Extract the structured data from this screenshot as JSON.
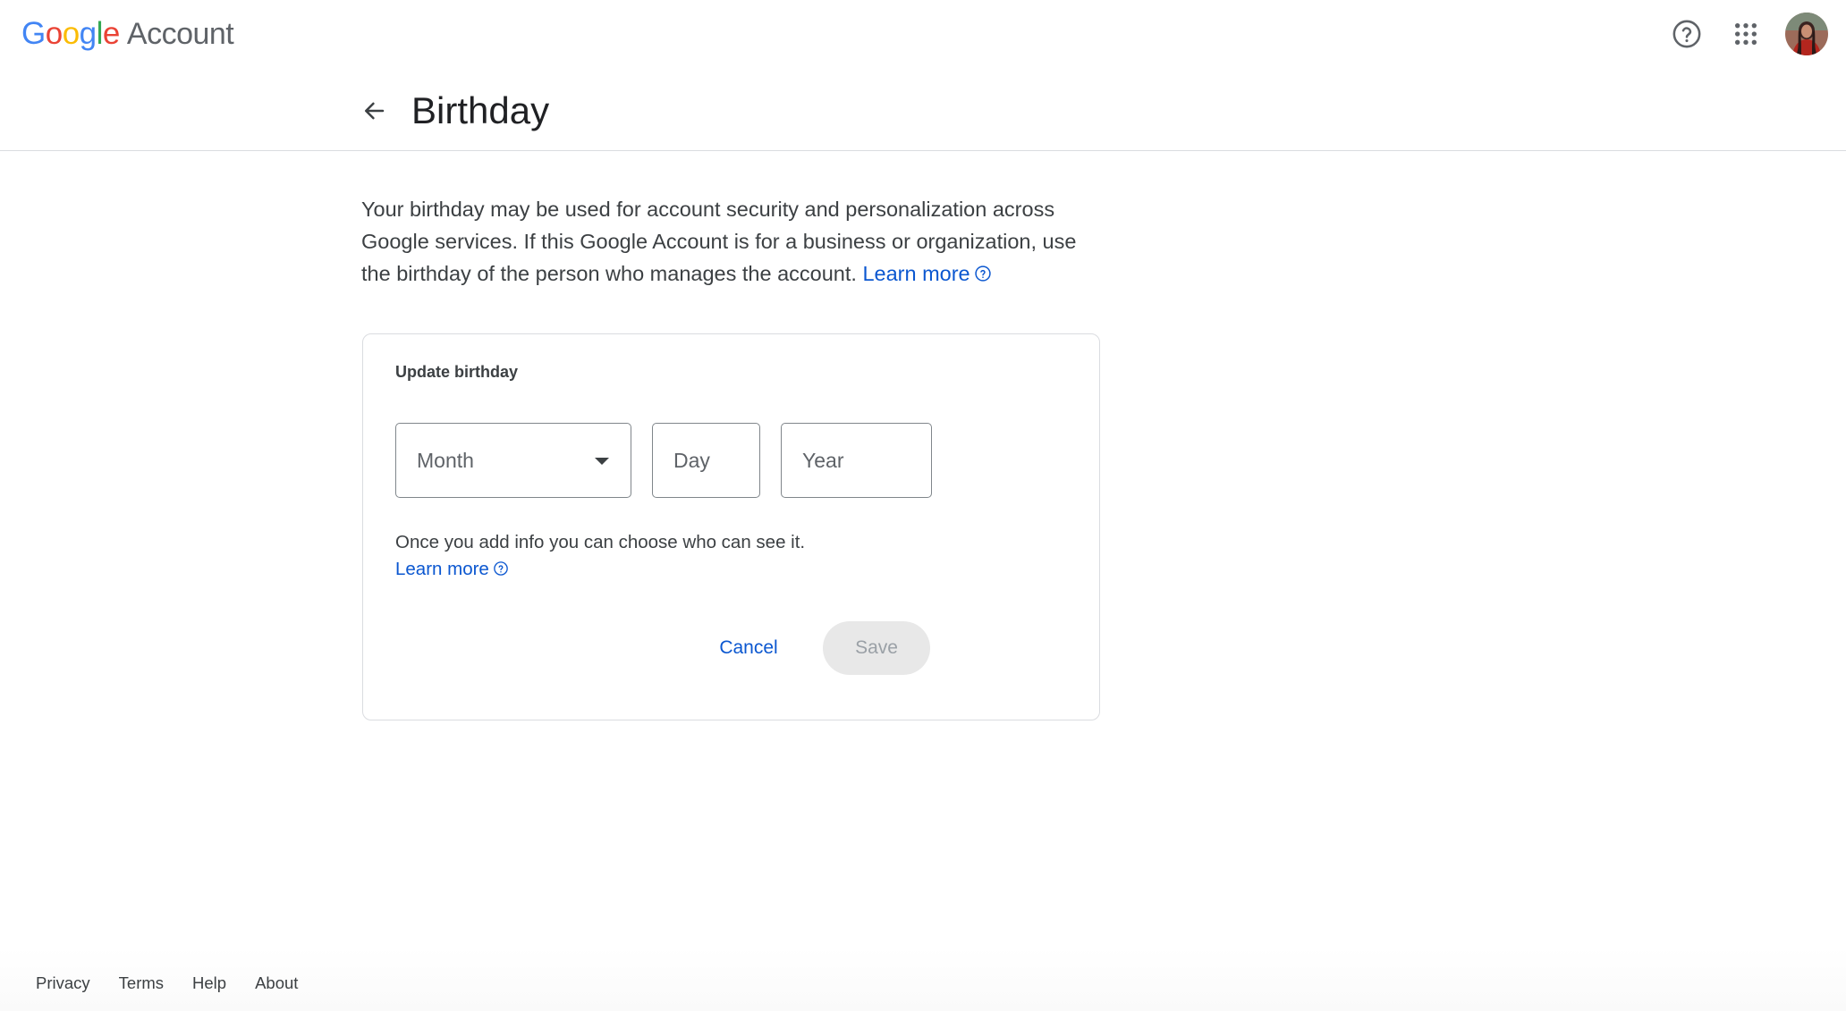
{
  "header": {
    "logo_letters": [
      {
        "char": "G",
        "color": "#4285F4"
      },
      {
        "char": "o",
        "color": "#EA4335"
      },
      {
        "char": "o",
        "color": "#FBBC05"
      },
      {
        "char": "g",
        "color": "#4285F4"
      },
      {
        "char": "l",
        "color": "#34A853"
      },
      {
        "char": "e",
        "color": "#EA4335"
      }
    ],
    "logo_google": "Google",
    "logo_account": "Account",
    "icons": [
      "help-icon",
      "apps-grid-icon",
      "avatar"
    ]
  },
  "page": {
    "title": "Birthday",
    "back_icon": "arrow-back-icon"
  },
  "description": {
    "text": "Your birthday may be used for account security and personalization across Google services. If this Google Account is for a business or organization, use the birthday of the person who manages the account.",
    "learn_more": "Learn more"
  },
  "form": {
    "title": "Update birthday",
    "month_placeholder": "Month",
    "day_placeholder": "Day",
    "year_placeholder": "Year",
    "info_text": "Once you add info you can choose who can see it.",
    "learn_more": "Learn more",
    "cancel_label": "Cancel",
    "save_label": "Save"
  },
  "footer": {
    "links": [
      "Privacy",
      "Terms",
      "Help",
      "About"
    ]
  },
  "colors": {
    "link": "#0b57d0",
    "border": "#dadce0",
    "save_disabled_bg": "#e8e8e8"
  }
}
